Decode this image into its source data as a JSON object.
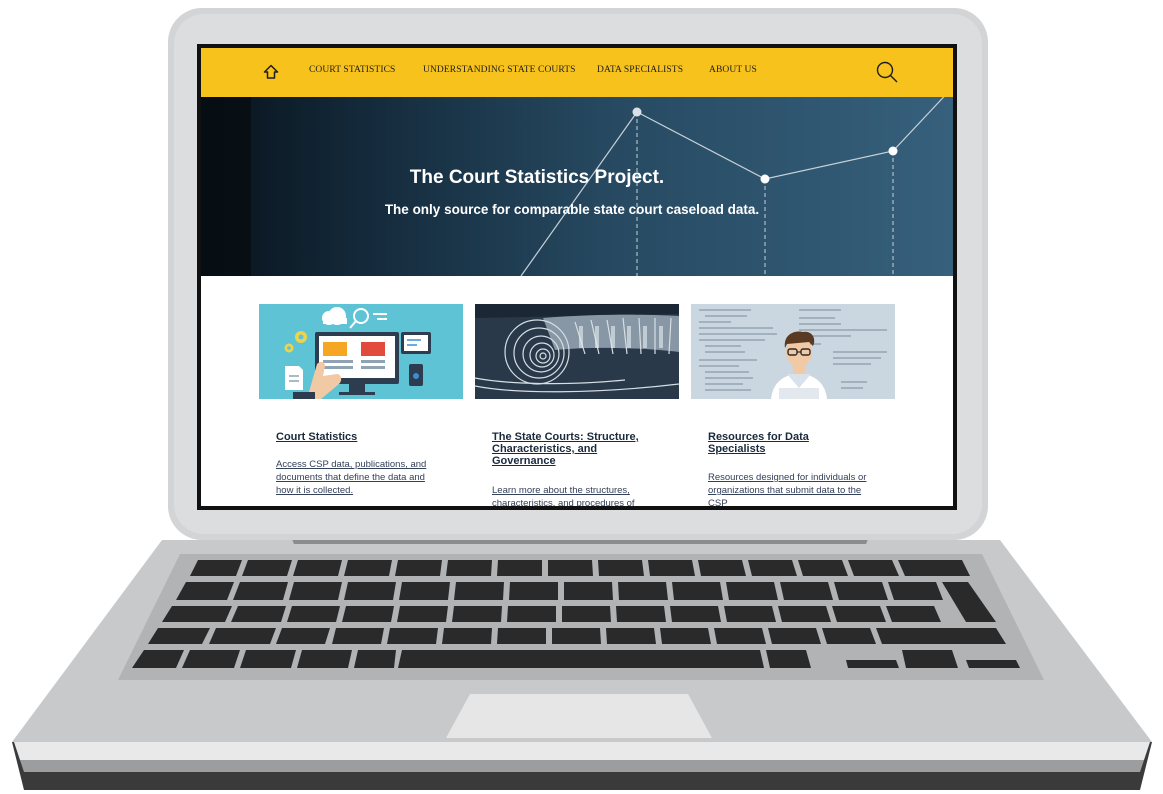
{
  "nav": {
    "items": [
      {
        "label": "COURT STATISTICS"
      },
      {
        "label": "UNDERSTANDING STATE COURTS"
      },
      {
        "label": "DATA SPECIALISTS"
      },
      {
        "label": "ABOUT US"
      }
    ],
    "icons": {
      "home": "home-icon",
      "search": "search-icon"
    }
  },
  "hero": {
    "title": "The Court Statistics Project.",
    "subtitle": "The only source for comparable state court caseload data."
  },
  "cards": [
    {
      "title": "Court Statistics",
      "description": "Access CSP data, publications, and documents that define the data and how it is collected."
    },
    {
      "title": "The State Courts: Structure, Characteristics, and Governance",
      "description": "Learn more about the structures, characteristics, and procedures of"
    },
    {
      "title": "Resources for Data Specialists",
      "description": "Resources designed for individuals or organizations that submit data to the CSP"
    }
  ],
  "colors": {
    "nav_background": "#f6c21b",
    "hero_background": "#1f3d55",
    "link": "#1b2a3c"
  }
}
